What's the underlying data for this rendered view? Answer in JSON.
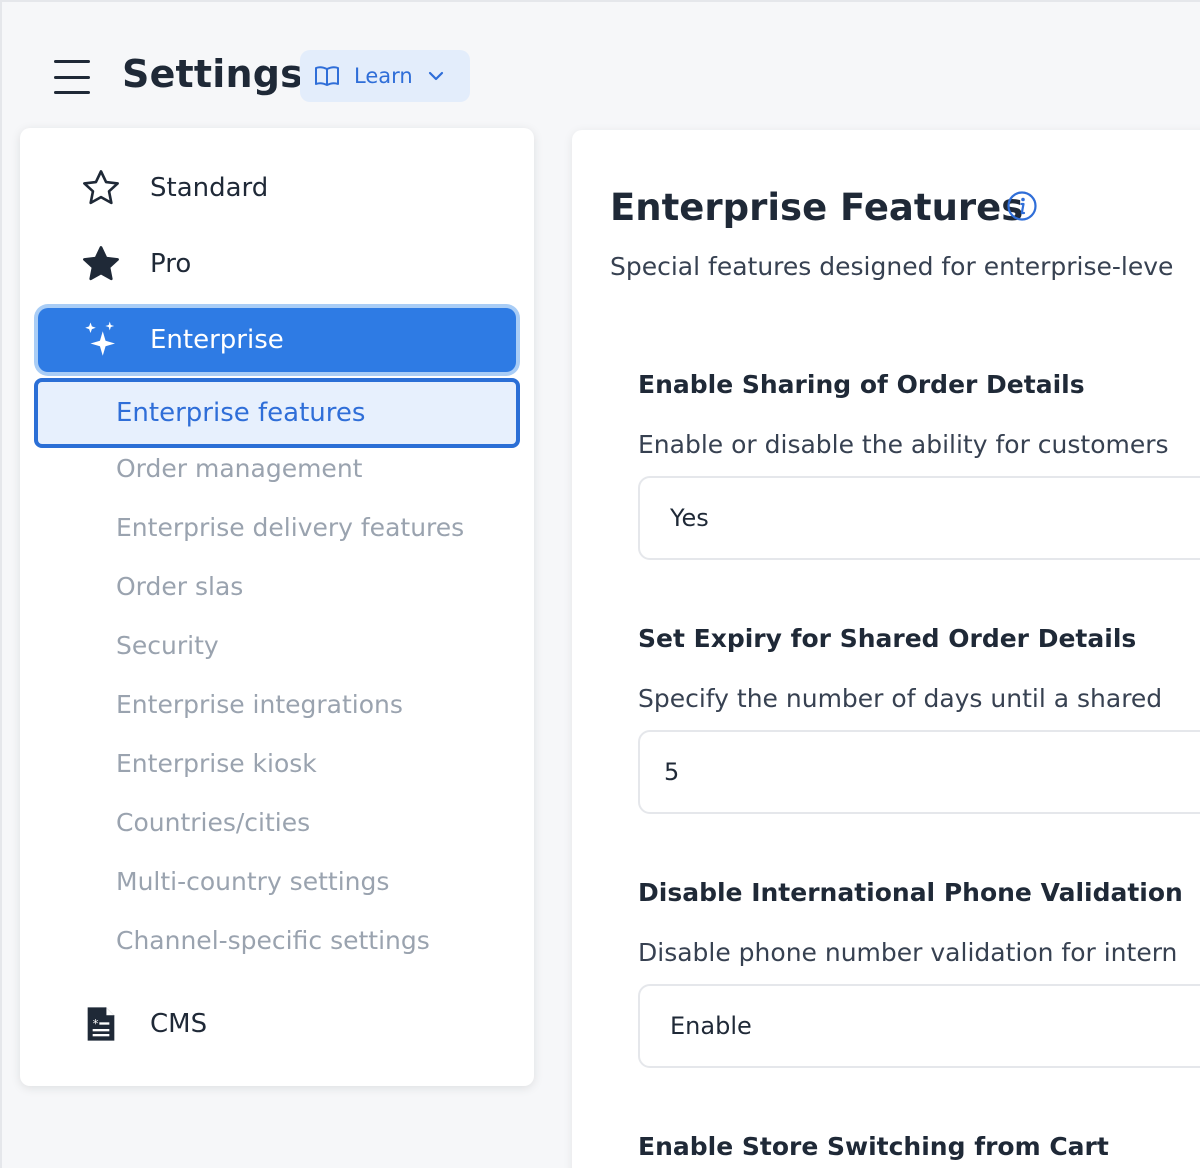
{
  "header": {
    "title": "Settings",
    "learn_label": "Learn"
  },
  "sidebar": {
    "items": [
      {
        "label": "Standard",
        "icon": "star-outline-icon"
      },
      {
        "label": "Pro",
        "icon": "star-filled-icon"
      },
      {
        "label": "Enterprise",
        "icon": "sparkles-icon",
        "active": true
      }
    ],
    "sub_items": [
      {
        "label": "Enterprise features",
        "active": true
      },
      {
        "label": "Order management"
      },
      {
        "label": "Enterprise delivery features"
      },
      {
        "label": "Order slas"
      },
      {
        "label": "Security"
      },
      {
        "label": "Enterprise integrations"
      },
      {
        "label": "Enterprise kiosk"
      },
      {
        "label": "Countries/cities"
      },
      {
        "label": "Multi-country settings"
      },
      {
        "label": "Channel-specific settings"
      }
    ],
    "cms": {
      "label": "CMS",
      "icon": "document-icon"
    }
  },
  "main": {
    "title": "Enterprise Features",
    "description": "Special features designed for enterprise-leve",
    "fields": [
      {
        "label": "Enable Sharing of Order Details",
        "description": "Enable or disable the ability for customers",
        "value": "Yes"
      },
      {
        "label": "Set Expiry for Shared Order Details",
        "description": "Specify the number of days until a shared",
        "value": "5"
      },
      {
        "label": "Disable International Phone Validation",
        "description": "Disable phone number validation for intern",
        "value": "Enable"
      },
      {
        "label": "Enable Store Switching from Cart"
      }
    ]
  },
  "colors": {
    "accent": "#2e7be4",
    "accent_light": "#e7f0fd",
    "muted_text": "#9aa3af",
    "learn_bg": "#e3edfb"
  }
}
